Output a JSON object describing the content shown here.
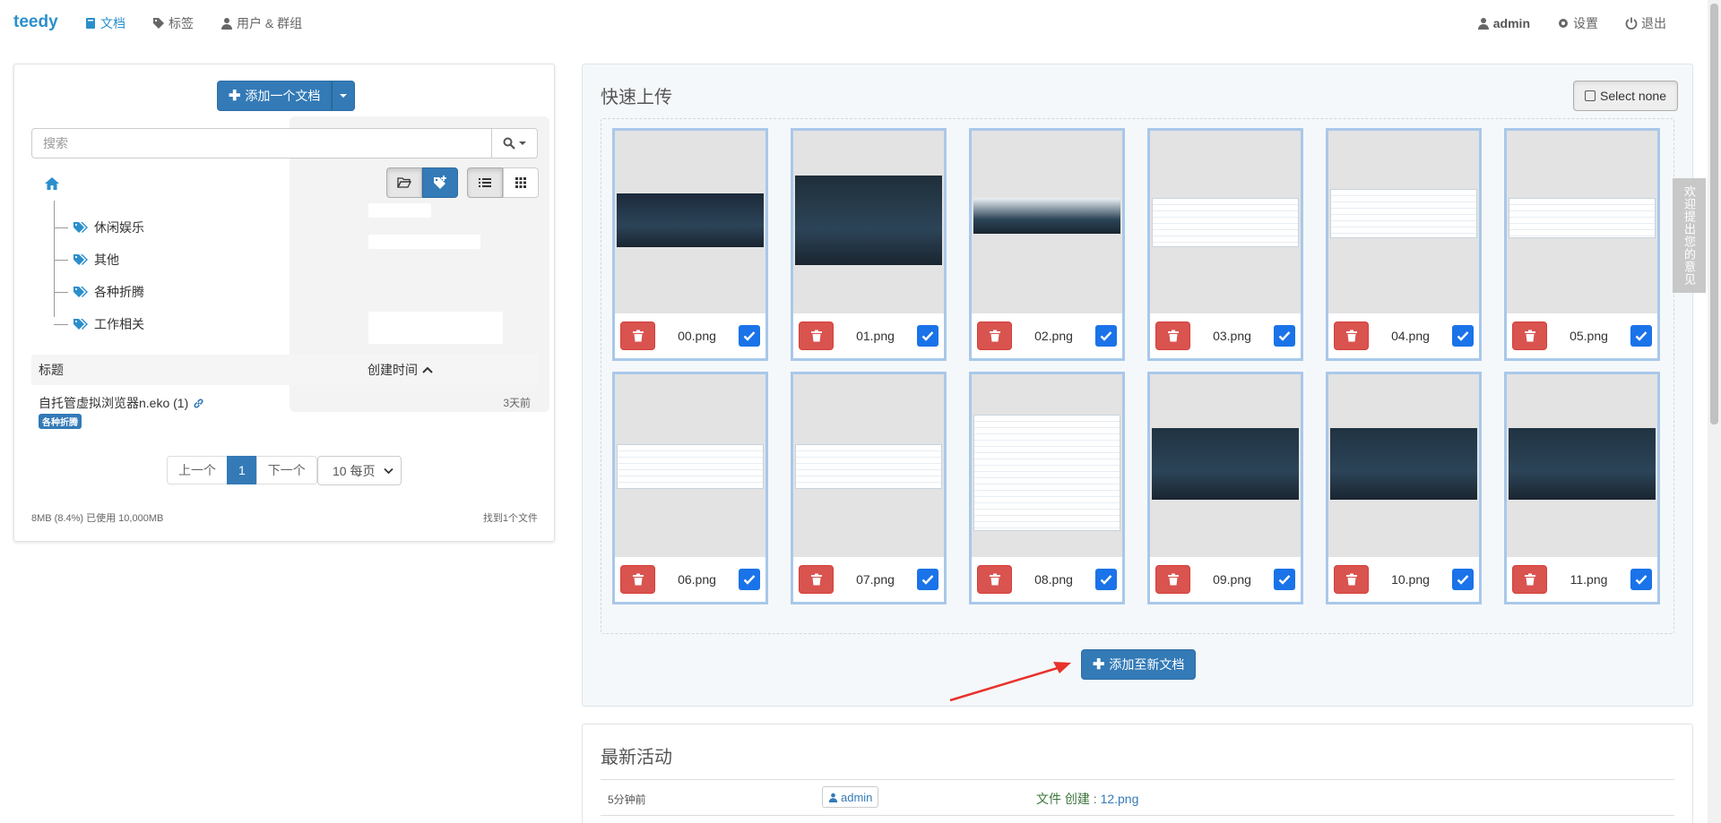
{
  "navbar": {
    "brand": "teedy",
    "left": [
      {
        "label": "文档",
        "icon": "book-icon",
        "active": true
      },
      {
        "label": "标签",
        "icon": "tags-icon",
        "active": false
      },
      {
        "label": "用户 & 群组",
        "icon": "user-icon",
        "active": false
      }
    ],
    "right": [
      {
        "label": "admin",
        "icon": "user-icon"
      },
      {
        "label": "设置",
        "icon": "gear-icon"
      },
      {
        "label": "退出",
        "icon": "power-icon"
      }
    ]
  },
  "feedback_tab": "欢迎提出您的意见",
  "left_panel": {
    "add_doc_label": "添加一个文档",
    "search_placeholder": "搜索",
    "tree": [
      "休闲娱乐",
      "其他",
      "各种折腾",
      "工作相关"
    ],
    "list_header": {
      "title": "标题",
      "date": "创建时间"
    },
    "documents": [
      {
        "title": "自托管虚拟浏览器n.eko (1)",
        "tag": "各种折腾",
        "date": "3天前"
      }
    ],
    "pagination": {
      "prev": "上一个",
      "current": "1",
      "next": "下一个",
      "per_page": "10 每页"
    },
    "storage": "8MB (8.4%) 已使用 10,000MB",
    "found": "找到1个文件"
  },
  "upload_panel": {
    "title": "快速上传",
    "select_none": "Select none",
    "files": [
      "00.png",
      "01.png",
      "02.png",
      "03.png",
      "04.png",
      "05.png",
      "06.png",
      "07.png",
      "08.png",
      "09.png",
      "10.png",
      "11.png"
    ],
    "add_to_new_doc": "添加至新文档"
  },
  "activity": {
    "title": "最新活动",
    "items": [
      {
        "time": "5分钟前",
        "user": "admin",
        "action": "文件 创建 : ",
        "file": "12.png"
      }
    ]
  },
  "colors": {
    "accent": "#337ab7",
    "brand": "#2a8fcc",
    "danger": "#d9534f",
    "checkbox": "#1a73e8",
    "selected_border": "#a9c8ea"
  }
}
